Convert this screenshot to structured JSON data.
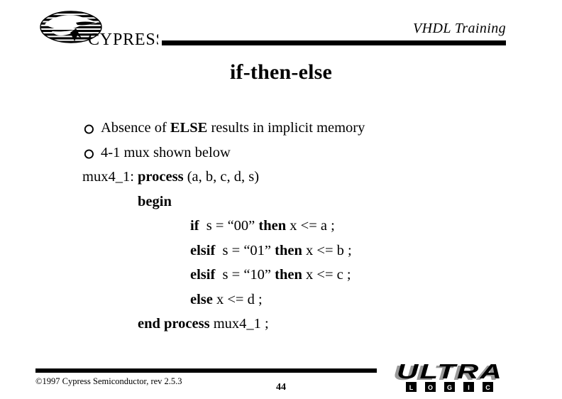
{
  "slide": {
    "header": {
      "title": "VHDL Training",
      "logo_name": "cypress-logo",
      "logo_text": "CYPRESS"
    },
    "title": "if-then-else",
    "bullets": [
      {
        "glyph": "shadowed-circle-bullet",
        "parts": [
          {
            "text": "Absence of ",
            "bold": false
          },
          {
            "text": "ELSE",
            "bold": true
          },
          {
            "text": " results in implicit memory",
            "bold": false
          }
        ],
        "plain": "Absence of ELSE results in implicit memory"
      },
      {
        "glyph": "shadowed-circle-bullet",
        "parts": [
          {
            "text": "4-1 mux shown below",
            "bold": false
          }
        ],
        "plain": "4-1 mux shown below"
      }
    ],
    "code": [
      {
        "indent": 0,
        "plain": "mux4_1: process (a, b, c, d, s)",
        "pre": "mux4_1: ",
        "kw": "process",
        "post": " (a, b, c, d, s)"
      },
      {
        "indent": 1,
        "plain": "begin",
        "pre": "",
        "kw": "begin",
        "post": ""
      },
      {
        "indent": 2,
        "plain": "if  s = “00” then x <= a ;",
        "kw1": "if",
        "mid1": "  s = “00” ",
        "kw2": "then",
        "post": " x <= a ;"
      },
      {
        "indent": 2,
        "plain": "elsif  s = “01” then x <= b ;",
        "kw1": "elsif",
        "mid1": "  s = “01” ",
        "kw2": "then",
        "post": " x <= b ;"
      },
      {
        "indent": 2,
        "plain": "elsif  s = “10” then x <= c ;",
        "kw1": "elsif",
        "mid1": "  s = “10” ",
        "kw2": "then",
        "post": " x <= c ;"
      },
      {
        "indent": 2,
        "plain": "else x <= d ;",
        "kw1": "else",
        "mid1": "",
        "kw2": "",
        "post": " x <= d ;"
      },
      {
        "indent": 3,
        "plain": "end process mux4_1 ;",
        "pre": "",
        "kw": "end process",
        "post": " mux4_1 ;"
      }
    ],
    "footer": {
      "copyright": "©1997 Cypress Semiconductor, rev 2.5.3",
      "page_number": "44",
      "logo_name": "ultra-logic-logo",
      "logo_word": "ULTRA",
      "logo_letters": [
        "L",
        "O",
        "G",
        "I",
        "C"
      ]
    }
  },
  "colors": {
    "background": "#ffffff",
    "foreground": "#000000",
    "logo_shadow_gray": "#999999"
  }
}
